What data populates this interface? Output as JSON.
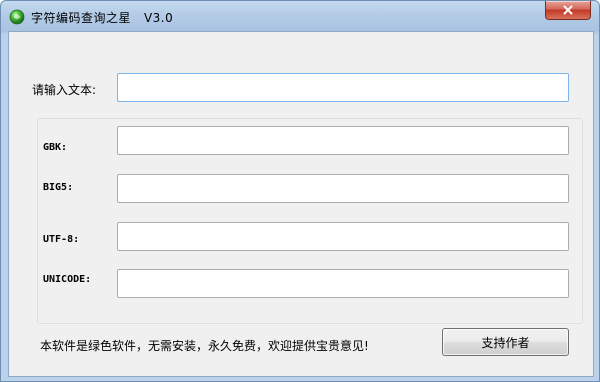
{
  "window": {
    "title": "字符编码查询之星   V3.0",
    "icon": "green-orb-icon",
    "close_icon": "close-icon"
  },
  "form": {
    "input_label": "请输入文本:",
    "input_value": "",
    "encodings": [
      {
        "label": "GBK:",
        "value": ""
      },
      {
        "label": "BIG5:",
        "value": ""
      },
      {
        "label": "UTF-8:",
        "value": ""
      },
      {
        "label": "UNICODE:",
        "value": ""
      }
    ]
  },
  "footer": {
    "notice": "本软件是绿色软件，无需安装，永久免费，欢迎提供宝贵意见!",
    "support_button": "支持作者"
  },
  "colors": {
    "titlebar": "#b3cbe6",
    "client_bg": "#f0f0f0",
    "close_button": "#c23a25",
    "focused_border": "#7eb4ea"
  }
}
